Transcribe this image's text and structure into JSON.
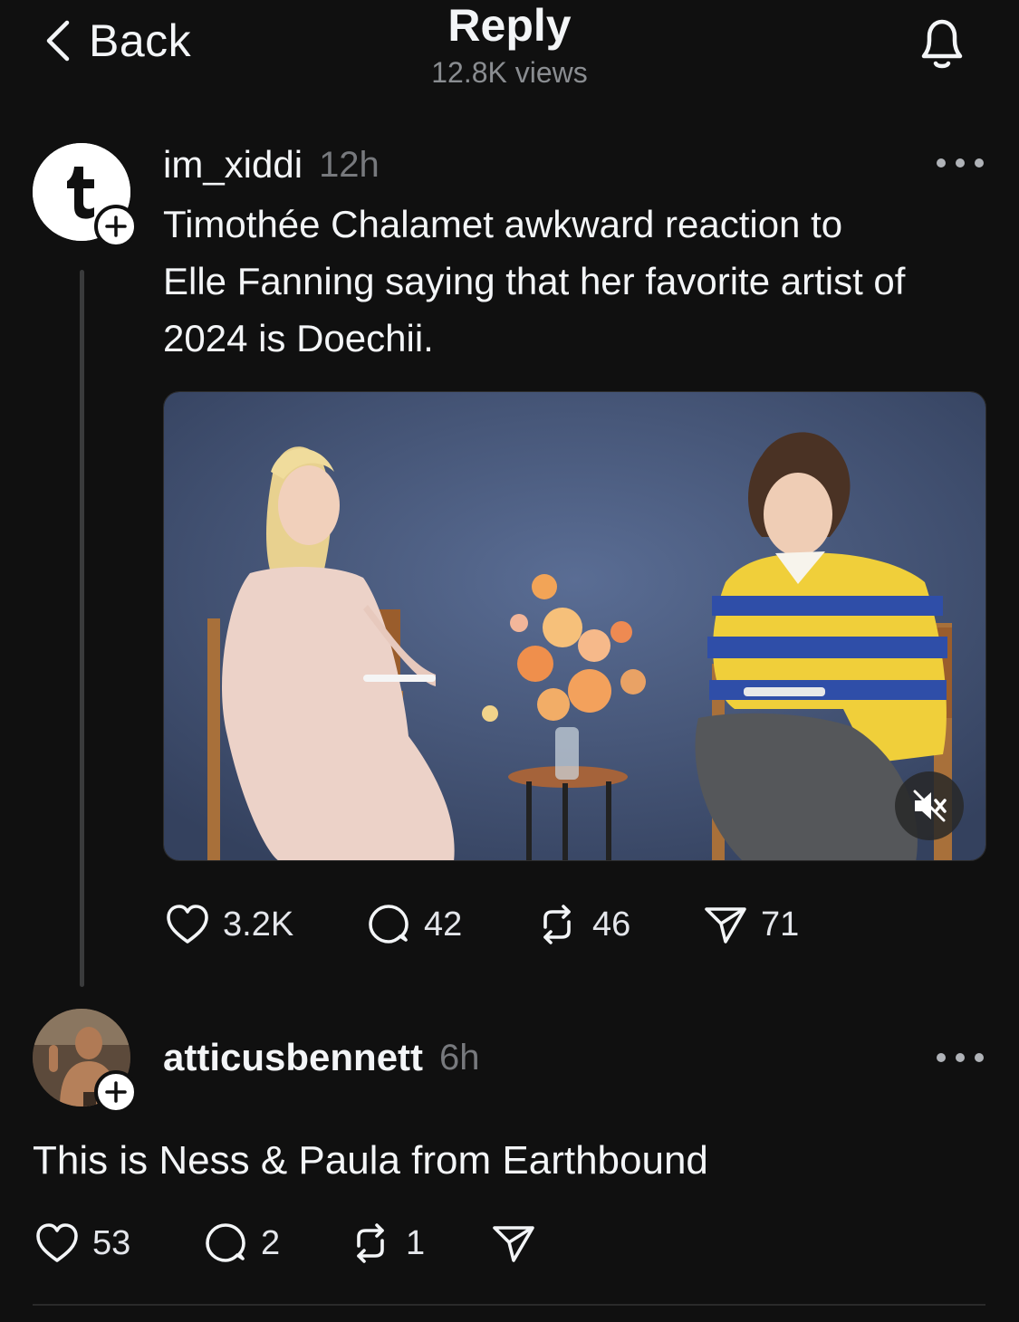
{
  "header": {
    "back_label": "Back",
    "title": "Reply",
    "views": "12.8K views"
  },
  "post": {
    "username": "im_xiddi",
    "time": "12h",
    "text_lines": [
      "Timothée Chalamet awkward reaction to",
      "Elle Fanning saying that her favorite artist of",
      "2024 is Doechii."
    ],
    "actions": {
      "likes": "3.2K",
      "comments": "42",
      "reposts": "46",
      "shares": "71"
    }
  },
  "reply": {
    "username": "atticusbennett",
    "time": "6h",
    "text": "This is Ness & Paula from Earthbound",
    "actions": {
      "likes": "53",
      "comments": "2",
      "reposts": "1"
    }
  },
  "colors": {
    "background": "#101010",
    "text": "#f3f5f7",
    "muted": "#77797d",
    "thread_line": "#3a3b3c"
  }
}
